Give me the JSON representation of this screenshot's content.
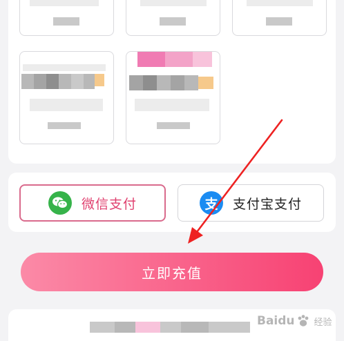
{
  "payment": {
    "wechat_label": "微信支付",
    "alipay_label": "支付宝支付",
    "alipay_glyph": "支",
    "selected": "wechat"
  },
  "actions": {
    "recharge_label": "立即充值"
  },
  "watermark": {
    "brand": "Baidu",
    "sub": "经验"
  },
  "colors": {
    "accent": "#f74273",
    "wechat": "#36b34a",
    "alipay": "#1b8cf2"
  },
  "icons": {
    "wechat": "wechat-icon",
    "alipay": "alipay-icon"
  }
}
